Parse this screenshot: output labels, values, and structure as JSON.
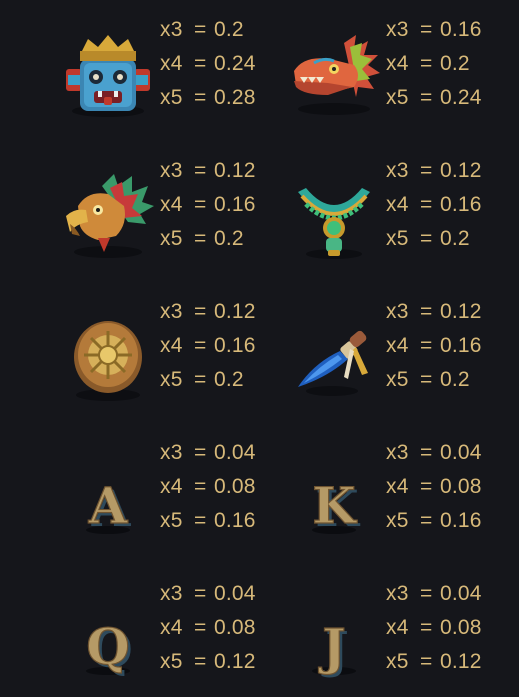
{
  "paytable": {
    "equals_sign": "=",
    "symbols": [
      {
        "icon": "stone-mask-icon",
        "pays": [
          {
            "mult": "x3",
            "value": "0.2"
          },
          {
            "mult": "x4",
            "value": "0.24"
          },
          {
            "mult": "x5",
            "value": "0.28"
          }
        ]
      },
      {
        "icon": "feathered-serpent-icon",
        "pays": [
          {
            "mult": "x3",
            "value": "0.16"
          },
          {
            "mult": "x4",
            "value": "0.2"
          },
          {
            "mult": "x5",
            "value": "0.24"
          }
        ]
      },
      {
        "icon": "eagle-head-icon",
        "pays": [
          {
            "mult": "x3",
            "value": "0.12"
          },
          {
            "mult": "x4",
            "value": "0.16"
          },
          {
            "mult": "x5",
            "value": "0.2"
          }
        ]
      },
      {
        "icon": "jade-necklace-icon",
        "pays": [
          {
            "mult": "x3",
            "value": "0.12"
          },
          {
            "mult": "x4",
            "value": "0.16"
          },
          {
            "mult": "x5",
            "value": "0.2"
          }
        ]
      },
      {
        "icon": "gold-shield-icon",
        "pays": [
          {
            "mult": "x3",
            "value": "0.12"
          },
          {
            "mult": "x4",
            "value": "0.16"
          },
          {
            "mult": "x5",
            "value": "0.2"
          }
        ]
      },
      {
        "icon": "obsidian-dagger-icon",
        "pays": [
          {
            "mult": "x3",
            "value": "0.12"
          },
          {
            "mult": "x4",
            "value": "0.16"
          },
          {
            "mult": "x5",
            "value": "0.2"
          }
        ]
      },
      {
        "icon": "letter-a-icon",
        "letter": "A",
        "pays": [
          {
            "mult": "x3",
            "value": "0.04"
          },
          {
            "mult": "x4",
            "value": "0.08"
          },
          {
            "mult": "x5",
            "value": "0.16"
          }
        ]
      },
      {
        "icon": "letter-k-icon",
        "letter": "K",
        "pays": [
          {
            "mult": "x3",
            "value": "0.04"
          },
          {
            "mult": "x4",
            "value": "0.08"
          },
          {
            "mult": "x5",
            "value": "0.16"
          }
        ]
      },
      {
        "icon": "letter-q-icon",
        "letter": "Q",
        "pays": [
          {
            "mult": "x3",
            "value": "0.04"
          },
          {
            "mult": "x4",
            "value": "0.08"
          },
          {
            "mult": "x5",
            "value": "0.12"
          }
        ]
      },
      {
        "icon": "letter-j-icon",
        "letter": "J",
        "pays": [
          {
            "mult": "x3",
            "value": "0.04"
          },
          {
            "mult": "x4",
            "value": "0.08"
          },
          {
            "mult": "x5",
            "value": "0.12"
          }
        ]
      }
    ]
  },
  "colors": {
    "background": "#15161b",
    "payout_text": "#d7b97a",
    "letter_face": "#b59a66",
    "letter_edge": "#2e4a5c"
  }
}
